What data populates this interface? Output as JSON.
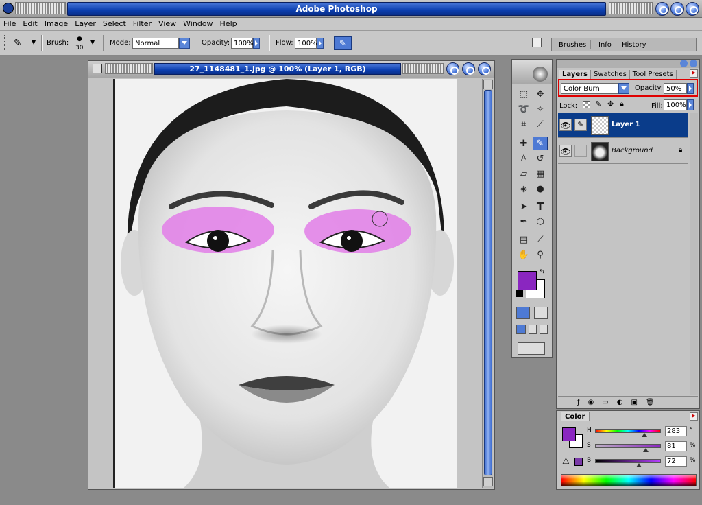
{
  "app": {
    "title": "Adobe Photoshop"
  },
  "menu": [
    "File",
    "Edit",
    "Image",
    "Layer",
    "Select",
    "Filter",
    "View",
    "Window",
    "Help"
  ],
  "options": {
    "brush_label": "Brush:",
    "brush_size": "30",
    "mode_label": "Mode:",
    "mode_value": "Normal",
    "opacity_label": "Opacity:",
    "opacity_value": "100%",
    "flow_label": "Flow:",
    "flow_value": "100%"
  },
  "palette_well": {
    "tabs": [
      "Brushes",
      "Info",
      "History"
    ]
  },
  "document": {
    "title": "27_1148481_1.jpg @ 100% (Layer 1, RGB)"
  },
  "layers_panel": {
    "tabs": [
      "Layers",
      "Swatches",
      "Tool Presets"
    ],
    "blend_mode": "Color Burn",
    "opacity_label": "Opacity:",
    "opacity_value": "50%",
    "lock_label": "Lock:",
    "fill_label": "Fill:",
    "fill_value": "100%",
    "layers": [
      {
        "name": "Layer 1",
        "selected": true
      },
      {
        "name": "Background",
        "selected": false
      }
    ]
  },
  "color_panel": {
    "tab": "Color",
    "h": {
      "label": "H",
      "value": "283",
      "unit": "°"
    },
    "s": {
      "label": "S",
      "value": "81",
      "unit": "%"
    },
    "b": {
      "label": "B",
      "value": "72",
      "unit": "%"
    }
  },
  "colors": {
    "foreground": "#8a26c0",
    "background": "#ffffff",
    "accent": "#0c3fb0",
    "highlight_box": "#e00000"
  }
}
